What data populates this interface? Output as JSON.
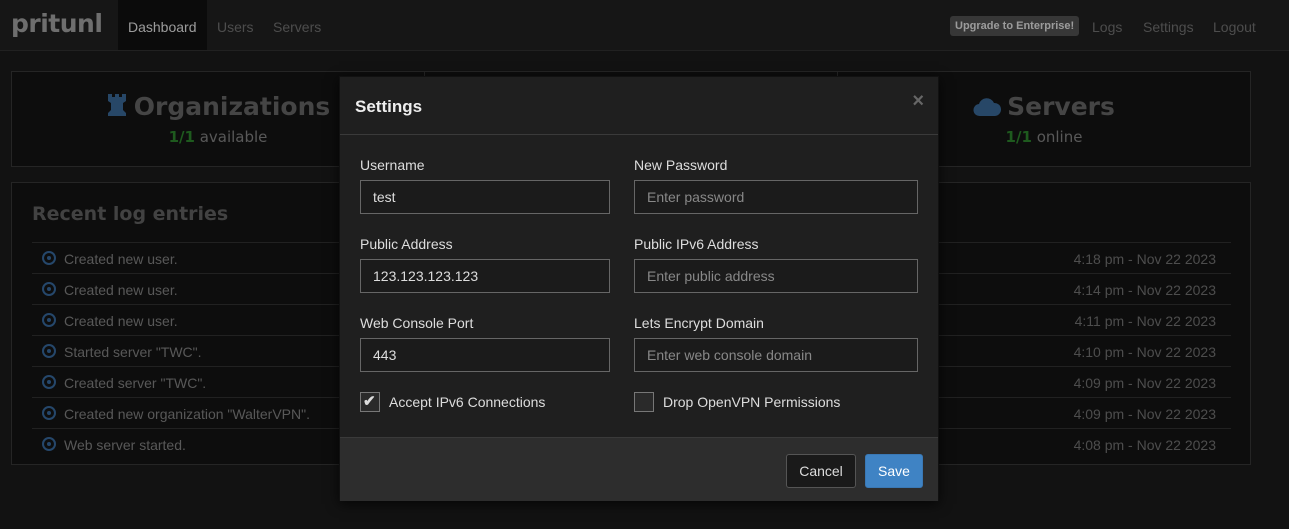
{
  "navbar": {
    "brand": "pritunl",
    "tabs": [
      {
        "label": "Dashboard",
        "active": true
      },
      {
        "label": "Users",
        "active": false
      },
      {
        "label": "Servers",
        "active": false
      }
    ],
    "enterprise_label": "Upgrade to Enterprise!",
    "right_links": [
      "Logs",
      "Settings",
      "Logout"
    ]
  },
  "stats": {
    "organizations": {
      "title": "Organizations",
      "count": "1/1",
      "status": "available",
      "icon": "rook-icon"
    },
    "servers": {
      "title": "Servers",
      "count": "1/1",
      "status": "online",
      "icon": "cloud-icon"
    }
  },
  "log": {
    "title": "Recent log entries",
    "entries": [
      {
        "message": "Created new user.",
        "time": "4:18 pm - Nov 22 2023"
      },
      {
        "message": "Created new user.",
        "time": "4:14 pm - Nov 22 2023"
      },
      {
        "message": "Created new user.",
        "time": "4:11 pm - Nov 22 2023"
      },
      {
        "message": "Started server \"TWC\".",
        "time": "4:10 pm - Nov 22 2023"
      },
      {
        "message": "Created server \"TWC\".",
        "time": "4:09 pm - Nov 22 2023"
      },
      {
        "message": "Created new organization \"WalterVPN\".",
        "time": "4:09 pm - Nov 22 2023"
      },
      {
        "message": "Web server started.",
        "time": "4:08 pm - Nov 22 2023"
      }
    ]
  },
  "modal": {
    "title": "Settings",
    "close_symbol": "×",
    "fields": {
      "username": {
        "label": "Username",
        "value": "test"
      },
      "new_password": {
        "label": "New Password",
        "placeholder": "Enter password"
      },
      "public_address": {
        "label": "Public Address",
        "value": "123.123.123.123"
      },
      "public_ipv6": {
        "label": "Public IPv6 Address",
        "placeholder": "Enter public address"
      },
      "web_console_port": {
        "label": "Web Console Port",
        "value": "443"
      },
      "lets_encrypt": {
        "label": "Lets Encrypt Domain",
        "placeholder": "Enter web console domain"
      }
    },
    "checkboxes": {
      "accept_ipv6": {
        "label": "Accept IPv6 Connections",
        "checked": true
      },
      "drop_openvpn": {
        "label": "Drop OpenVPN Permissions",
        "checked": false
      }
    },
    "cancel_label": "Cancel",
    "save_label": "Save"
  },
  "colors": {
    "accent": "#3f83c4",
    "available": "#2f8a2f",
    "log_icon": "#3a6ea5"
  }
}
